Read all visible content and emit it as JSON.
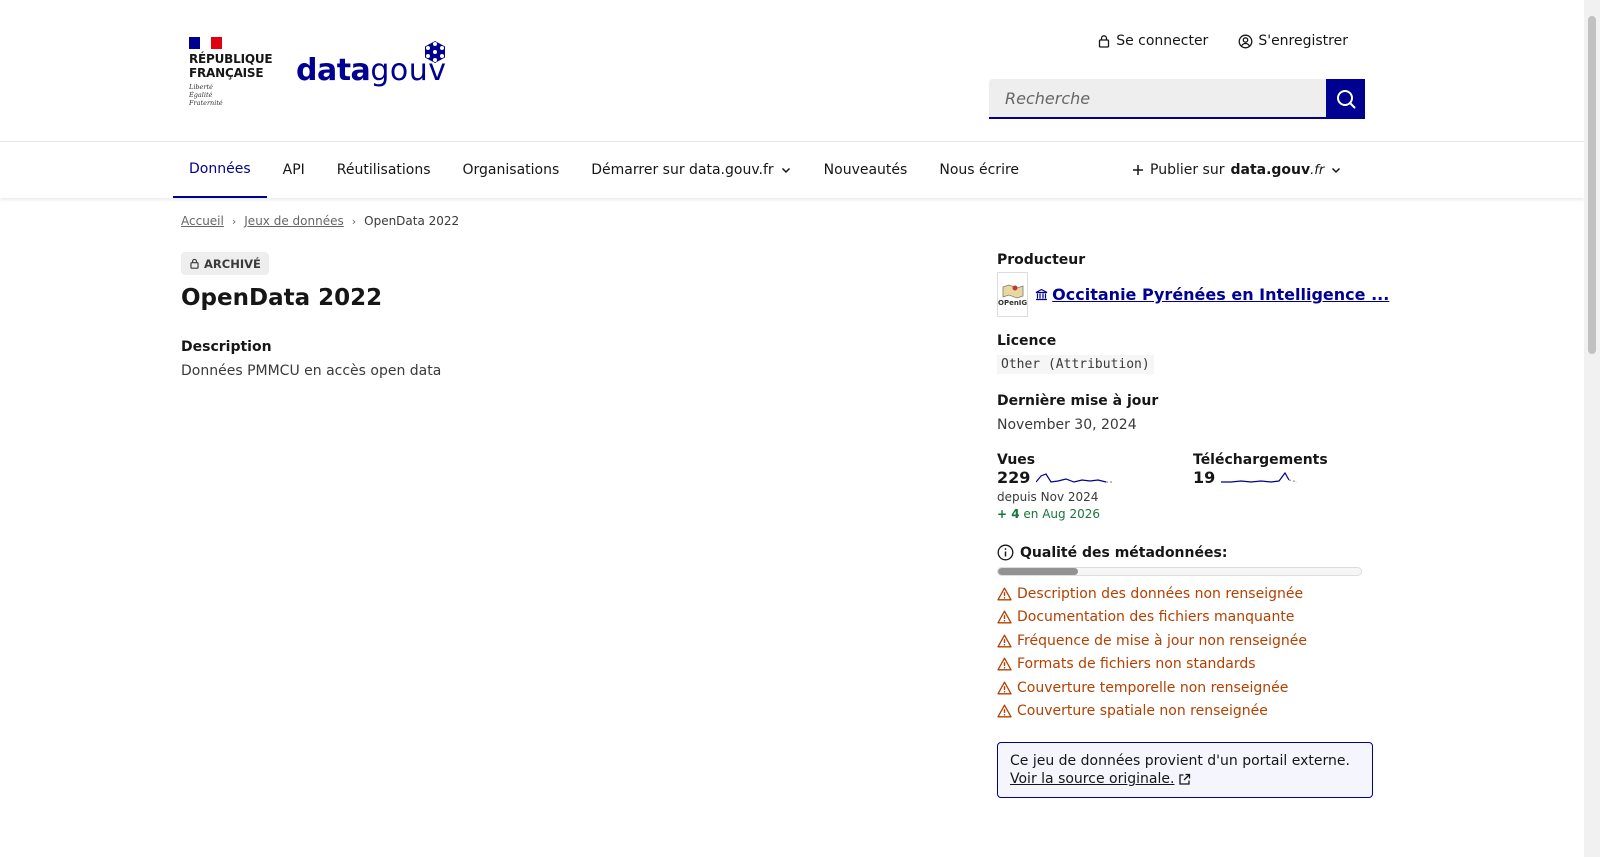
{
  "header": {
    "gov_label_line1": "RÉPUBLIQUE",
    "gov_label_line2": "FRANÇAISE",
    "devise1": "Liberté",
    "devise2": "Égalité",
    "devise3": "Fraternité",
    "brand_bold": "data",
    "brand_light": "gouv",
    "login": "Se connecter",
    "register": "S'enregistrer",
    "search_placeholder": "Recherche"
  },
  "nav": {
    "items": [
      {
        "label": "Données"
      },
      {
        "label": "API"
      },
      {
        "label": "Réutilisations"
      },
      {
        "label": "Organisations"
      },
      {
        "label": "Démarrer sur data.gouv.fr"
      },
      {
        "label": "Nouveautés"
      },
      {
        "label": "Nous écrire"
      }
    ],
    "publish_prefix": "Publier sur",
    "publish_brand": "data.gouv",
    "publish_tld": ".fr"
  },
  "breadcrumb": {
    "home": "Accueil",
    "datasets": "Jeux de données",
    "current": "OpenData 2022"
  },
  "dataset": {
    "badge": "ARCHIVÉ",
    "title": "OpenData 2022",
    "description_label": "Description",
    "description": "Données PMMCU en accès open data"
  },
  "sidebar": {
    "producer_label": "Producteur",
    "producer_name": "Occitanie Pyrénées en Intelligence ...",
    "producer_logo_text": "OPenIG",
    "license_label": "Licence",
    "license": "Other (Attribution)",
    "updated_label": "Dernière mise à jour",
    "updated": "November 30, 2024",
    "views_label": "Vues",
    "views": "229",
    "since": "depuis Nov 2024",
    "views_delta": "+ 4",
    "views_delta_suffix": "en Aug 2026",
    "downloads_label": "Téléchargements",
    "downloads": "19",
    "quality_label": "Qualité des métadonnées:",
    "quality_score": 0.22,
    "warnings": [
      "Description des données non renseignée",
      "Documentation des fichiers manquante",
      "Fréquence de mise à jour non renseignée",
      "Formats de fichiers non standards",
      "Couverture temporelle non renseignée",
      "Couverture spatiale non renseignée"
    ],
    "notice_text": "Ce jeu de données provient d'un portail externe.",
    "notice_link": "Voir la source originale."
  },
  "colors": {
    "primary": "#000091",
    "warning": "#b34000",
    "success": "#18753c"
  }
}
